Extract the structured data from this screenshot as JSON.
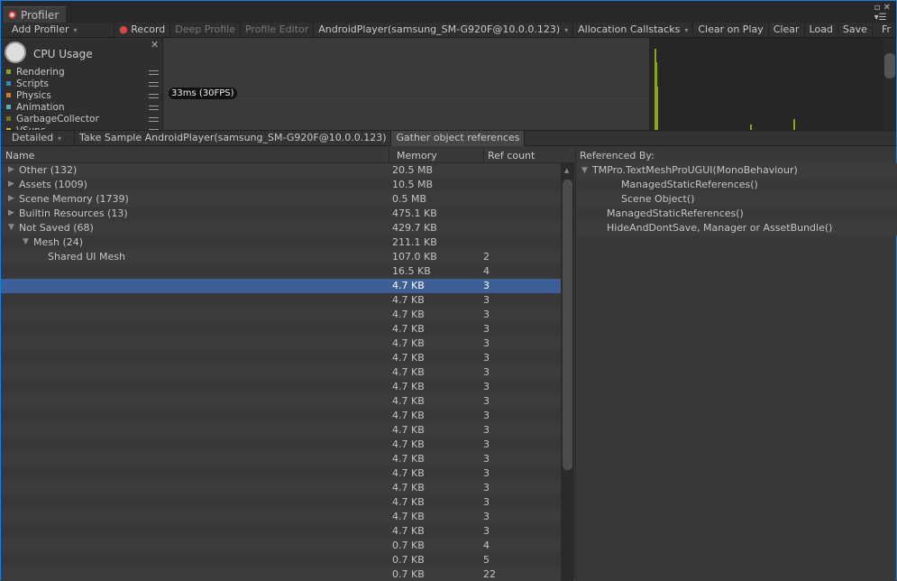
{
  "window": {
    "tab": "Profiler"
  },
  "toolbar": {
    "add_profiler": "Add Profiler",
    "record": "Record",
    "deep_profile": "Deep Profile",
    "profile_editor": "Profile Editor",
    "target": "AndroidPlayer(samsung_SM-G920F@10.0.0.123)",
    "allocation": "Allocation Callstacks",
    "clear_on_play": "Clear on Play",
    "clear": "Clear",
    "load": "Load",
    "save": "Save",
    "frame": "Fr"
  },
  "sidebar": {
    "title": "CPU Usage",
    "items": [
      {
        "label": "Rendering",
        "color": "#7fa81c"
      },
      {
        "label": "Scripts",
        "color": "#2c8cbd"
      },
      {
        "label": "Physics",
        "color": "#d97b16"
      },
      {
        "label": "Animation",
        "color": "#49b3c6"
      },
      {
        "label": "GarbageCollector",
        "color": "#7a7318"
      },
      {
        "label": "VSync",
        "color": "#d4b51a"
      }
    ]
  },
  "chart": {
    "fps_label": "33ms (30FPS)",
    "bar_color": "#88a80e"
  },
  "detail_bar": {
    "mode": "Detailed",
    "take_sample": "Take Sample AndroidPlayer(samsung_SM-G920F@10.0.0.123)",
    "gather": "Gather object references"
  },
  "table": {
    "columns": [
      "Name",
      "Memory",
      "Ref count"
    ],
    "rows": [
      {
        "name": "Other (132)",
        "memory": "20.5 MB",
        "refs": "",
        "indent": 0,
        "arrow": "right"
      },
      {
        "name": "Assets (1009)",
        "memory": "10.5 MB",
        "refs": "",
        "indent": 0,
        "arrow": "right"
      },
      {
        "name": "Scene Memory (1739)",
        "memory": "0.5 MB",
        "refs": "",
        "indent": 0,
        "arrow": "right"
      },
      {
        "name": "Builtin Resources (13)",
        "memory": "475.1 KB",
        "refs": "",
        "indent": 0,
        "arrow": "right"
      },
      {
        "name": "Not Saved (68)",
        "memory": "429.7 KB",
        "refs": "",
        "indent": 0,
        "arrow": "down"
      },
      {
        "name": "Mesh (24)",
        "memory": "211.1 KB",
        "refs": "",
        "indent": 1,
        "arrow": "down"
      },
      {
        "name": "Shared UI Mesh",
        "memory": "107.0 KB",
        "refs": "2",
        "indent": 2,
        "arrow": ""
      },
      {
        "name": "",
        "memory": "16.5 KB",
        "refs": "4",
        "indent": 2,
        "arrow": ""
      },
      {
        "name": "",
        "memory": "4.7 KB",
        "refs": "3",
        "indent": 2,
        "arrow": "",
        "selected": true
      },
      {
        "name": "",
        "memory": "4.7 KB",
        "refs": "3",
        "indent": 2,
        "arrow": ""
      },
      {
        "name": "",
        "memory": "4.7 KB",
        "refs": "3",
        "indent": 2,
        "arrow": ""
      },
      {
        "name": "",
        "memory": "4.7 KB",
        "refs": "3",
        "indent": 2,
        "arrow": ""
      },
      {
        "name": "",
        "memory": "4.7 KB",
        "refs": "3",
        "indent": 2,
        "arrow": ""
      },
      {
        "name": "",
        "memory": "4.7 KB",
        "refs": "3",
        "indent": 2,
        "arrow": ""
      },
      {
        "name": "",
        "memory": "4.7 KB",
        "refs": "3",
        "indent": 2,
        "arrow": ""
      },
      {
        "name": "",
        "memory": "4.7 KB",
        "refs": "3",
        "indent": 2,
        "arrow": ""
      },
      {
        "name": "",
        "memory": "4.7 KB",
        "refs": "3",
        "indent": 2,
        "arrow": ""
      },
      {
        "name": "",
        "memory": "4.7 KB",
        "refs": "3",
        "indent": 2,
        "arrow": ""
      },
      {
        "name": "",
        "memory": "4.7 KB",
        "refs": "3",
        "indent": 2,
        "arrow": ""
      },
      {
        "name": "",
        "memory": "4.7 KB",
        "refs": "3",
        "indent": 2,
        "arrow": ""
      },
      {
        "name": "",
        "memory": "4.7 KB",
        "refs": "3",
        "indent": 2,
        "arrow": ""
      },
      {
        "name": "",
        "memory": "4.7 KB",
        "refs": "3",
        "indent": 2,
        "arrow": ""
      },
      {
        "name": "",
        "memory": "4.7 KB",
        "refs": "3",
        "indent": 2,
        "arrow": ""
      },
      {
        "name": "",
        "memory": "4.7 KB",
        "refs": "3",
        "indent": 2,
        "arrow": ""
      },
      {
        "name": "",
        "memory": "4.7 KB",
        "refs": "3",
        "indent": 2,
        "arrow": ""
      },
      {
        "name": "",
        "memory": "4.7 KB",
        "refs": "3",
        "indent": 2,
        "arrow": ""
      },
      {
        "name": "",
        "memory": "0.7 KB",
        "refs": "4",
        "indent": 2,
        "arrow": ""
      },
      {
        "name": "",
        "memory": "0.7 KB",
        "refs": "5",
        "indent": 2,
        "arrow": ""
      },
      {
        "name": "",
        "memory": "0.7 KB",
        "refs": "22",
        "indent": 2,
        "arrow": ""
      }
    ]
  },
  "referenced_by": {
    "title": "Referenced By:",
    "items": [
      {
        "label": "TMPro.TextMeshProUGUI(MonoBehaviour)",
        "indent": 0,
        "arrow": "down"
      },
      {
        "label": "ManagedStaticReferences()",
        "indent": 2,
        "arrow": ""
      },
      {
        "label": "Scene Object()",
        "indent": 2,
        "arrow": ""
      },
      {
        "label": "ManagedStaticReferences()",
        "indent": 1,
        "arrow": ""
      },
      {
        "label": "HideAndDontSave, Manager or AssetBundle()",
        "indent": 1,
        "arrow": ""
      }
    ]
  }
}
